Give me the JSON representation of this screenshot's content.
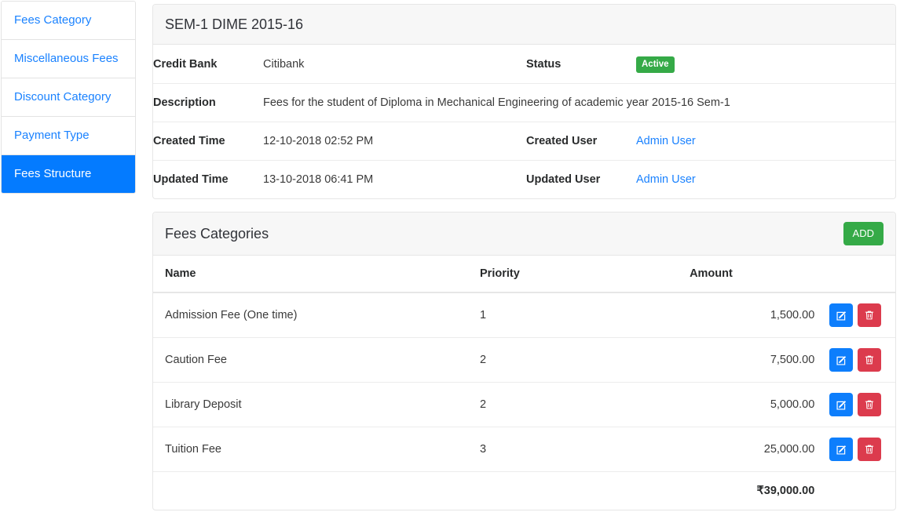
{
  "sidebar": {
    "items": [
      {
        "label": "Fees Category",
        "active": false
      },
      {
        "label": "Miscellaneous Fees",
        "active": false
      },
      {
        "label": "Discount Category",
        "active": false
      },
      {
        "label": "Payment Type",
        "active": false
      },
      {
        "label": "Fees Structure",
        "active": true
      }
    ]
  },
  "detail_card": {
    "title": "SEM-1 DIME 2015-16",
    "labels": {
      "credit_bank": "Credit Bank",
      "status": "Status",
      "description": "Description",
      "created_time": "Created Time",
      "created_user": "Created User",
      "updated_time": "Updated Time",
      "updated_user": "Updated User"
    },
    "values": {
      "credit_bank": "Citibank",
      "status": "Active",
      "description": "Fees for the student of Diploma in Mechanical Engineering of academic year 2015-16 Sem-1",
      "created_time": "12-10-2018 02:52 PM",
      "created_user": "Admin User",
      "updated_time": "13-10-2018 06:41 PM",
      "updated_user": "Admin User"
    }
  },
  "fees_card": {
    "title": "Fees Categories",
    "add_label": "ADD",
    "columns": {
      "name": "Name",
      "priority": "Priority",
      "amount": "Amount"
    },
    "rows": [
      {
        "name": "Admission Fee (One time)",
        "priority": "1",
        "amount": "1,500.00"
      },
      {
        "name": "Caution Fee",
        "priority": "2",
        "amount": "7,500.00"
      },
      {
        "name": "Library Deposit",
        "priority": "2",
        "amount": "5,000.00"
      },
      {
        "name": "Tuition Fee",
        "priority": "3",
        "amount": "25,000.00"
      }
    ],
    "total": "₹39,000.00"
  },
  "colors": {
    "accent_blue": "#047bff",
    "link_blue": "#1a82ff",
    "success_green": "#35aa47",
    "danger_red": "#dc3b4d",
    "edit_blue": "#0d7efc"
  }
}
